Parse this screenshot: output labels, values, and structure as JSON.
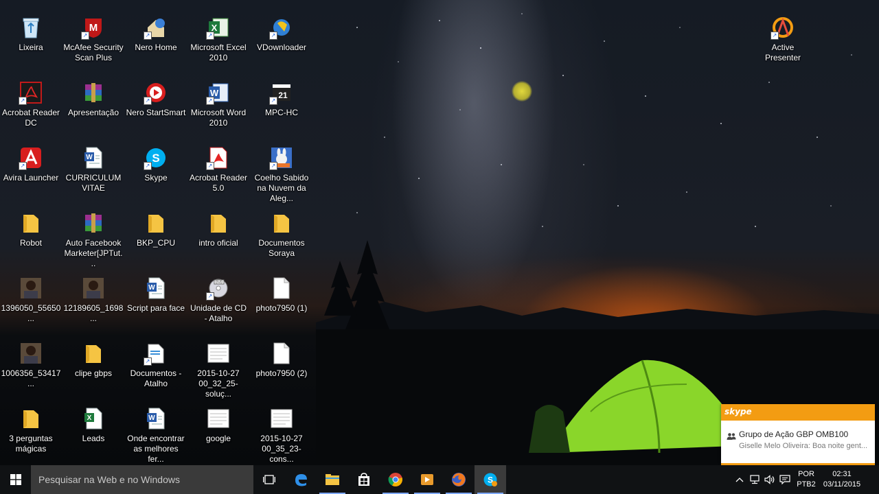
{
  "desktop": {
    "icons": [
      {
        "label": "Lixeira",
        "icon": "recycle-bin-icon"
      },
      {
        "label": "McAfee Security Scan Plus",
        "icon": "mcafee-icon"
      },
      {
        "label": "Nero Home",
        "icon": "nero-home-icon"
      },
      {
        "label": "Microsoft Excel 2010",
        "icon": "excel-icon"
      },
      {
        "label": "VDownloader",
        "icon": "vdownloader-icon"
      },
      {
        "label": "Active Presenter",
        "icon": "active-presenter-icon"
      },
      {
        "label": "Acrobat Reader DC",
        "icon": "acrobat-icon"
      },
      {
        "label": "Apresentação",
        "icon": "winrar-icon"
      },
      {
        "label": "Nero StartSmart",
        "icon": "nero-startsmart-icon"
      },
      {
        "label": "Microsoft Word 2010",
        "icon": "word-icon"
      },
      {
        "label": "MPC-HC",
        "icon": "mpc-hc-icon"
      },
      {
        "label": "Avira Launcher",
        "icon": "avira-icon"
      },
      {
        "label": "CURRICULUM VITAE",
        "icon": "word-document-icon"
      },
      {
        "label": "Skype",
        "icon": "skype-icon"
      },
      {
        "label": "Acrobat Reader 5.0",
        "icon": "acrobat-reader5-icon"
      },
      {
        "label": "Coelho Sabido na Nuvem da Aleg...",
        "icon": "coelho-sabido-icon"
      },
      {
        "label": "Robot",
        "icon": "folder-icon"
      },
      {
        "label": "Auto Facebook Marketer[JPTut...",
        "icon": "winrar-icon"
      },
      {
        "label": "BKP_CPU",
        "icon": "folder-icon"
      },
      {
        "label": "intro oficial",
        "icon": "folder-icon"
      },
      {
        "label": "Documentos Soraya",
        "icon": "folder-icon"
      },
      {
        "label": "1396050_55650...",
        "icon": "photo-icon"
      },
      {
        "label": "12189605_1698...",
        "icon": "photo-icon"
      },
      {
        "label": "Script para face",
        "icon": "word-document-icon"
      },
      {
        "label": "Unidade de CD - Atalho",
        "icon": "cd-drive-icon"
      },
      {
        "label": "photo7950 (1)",
        "icon": "file-icon"
      },
      {
        "label": "1006356_53417...",
        "icon": "photo-icon"
      },
      {
        "label": "clipe gbps",
        "icon": "folder-icon"
      },
      {
        "label": "Documentos - Atalho",
        "icon": "documents-shortcut-icon"
      },
      {
        "label": "2015-10-27 00_32_25-soluç...",
        "icon": "text-file-icon"
      },
      {
        "label": "photo7950 (2)",
        "icon": "file-icon"
      },
      {
        "label": "3 perguntas mágicas",
        "icon": "folder-icon"
      },
      {
        "label": "Leads",
        "icon": "excel-document-icon"
      },
      {
        "label": "Onde encontrar as melhores fer...",
        "icon": "word-document-icon"
      },
      {
        "label": "google",
        "icon": "text-file-icon"
      },
      {
        "label": "2015-10-27 00_35_23-cons...",
        "icon": "text-file-icon"
      }
    ]
  },
  "notification": {
    "app": "skype",
    "title": "Grupo de Ação GBP OMB100",
    "body": "Giselle Melo Oliveira: Boa noite gent...",
    "accent": "#f39c12"
  },
  "taskbar": {
    "search_placeholder": "Pesquisar na Web e no Windows",
    "apps": [
      "task-view-icon",
      "edge-icon",
      "file-explorer-icon",
      "store-icon",
      "chrome-icon",
      "media-player-icon",
      "firefox-icon",
      "skype-icon"
    ],
    "tray": {
      "language": "POR",
      "keyboard": "PTB2",
      "time": "02:31",
      "date": "03/11/2015"
    }
  }
}
